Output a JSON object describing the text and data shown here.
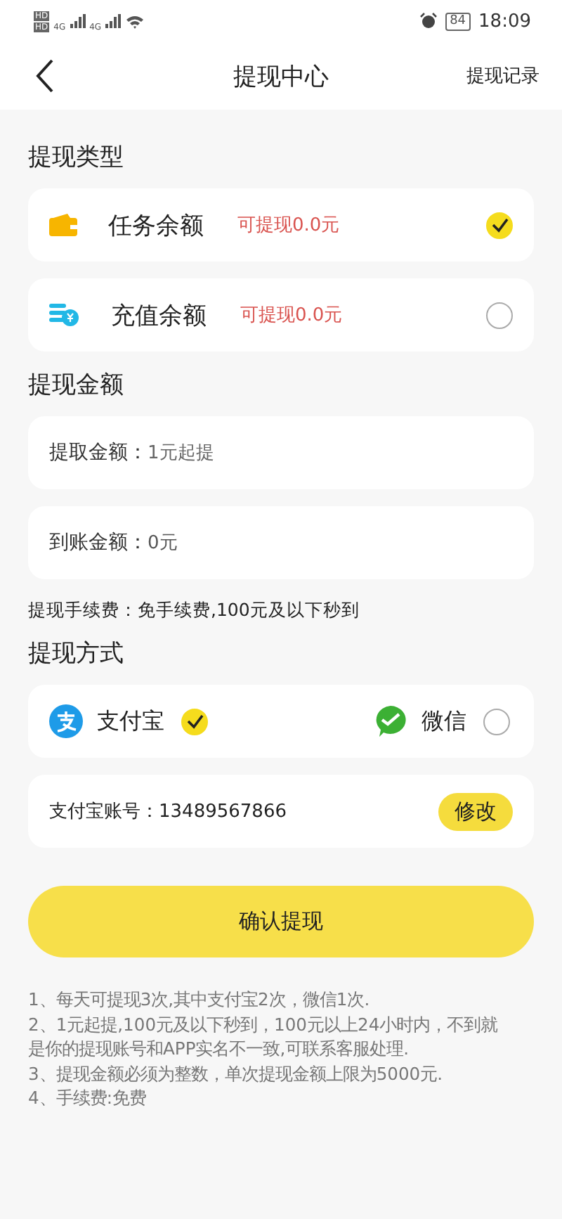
{
  "status_bar": {
    "hd": [
      "HD",
      "HD"
    ],
    "network": [
      "4G",
      "4G"
    ],
    "battery": "84",
    "time": "18:09"
  },
  "header": {
    "title": "提现中心",
    "action": "提现记录"
  },
  "type_section": {
    "title": "提现类型",
    "options": [
      {
        "kind": "wallet",
        "label": "任务余额",
        "available": "可提现0.0元",
        "selected": true
      },
      {
        "kind": "coins",
        "label": "充值余额",
        "available": "可提现0.0元",
        "selected": false
      }
    ]
  },
  "amount_section": {
    "title": "提现金额",
    "amount": {
      "label": "提取金额：",
      "placeholder": "1元起提"
    },
    "received": {
      "label": "到账金额：",
      "value": "0元"
    },
    "fee": "提现手续费：免手续费,100元及以下秒到"
  },
  "method_section": {
    "title": "提现方式",
    "methods": [
      {
        "kind": "alipay",
        "label": "支付宝",
        "selected": true
      },
      {
        "kind": "wechat",
        "label": "微信",
        "selected": false
      }
    ],
    "account": {
      "label": "支付宝账号：",
      "value": "13489567866",
      "edit": "修改"
    }
  },
  "confirm": "确认提现",
  "notes": [
    "1、每天可提现3次,其中支付宝2次，微信1次.",
    "2、1元起提,100元及以下秒到，100元以上24小时内，不到就是你的提现账号和APP实名不一致,可联系客服处理.",
    "3、提现金额必须为整数，单次提现金额上限为5000元.",
    "4、手续费:免费"
  ]
}
